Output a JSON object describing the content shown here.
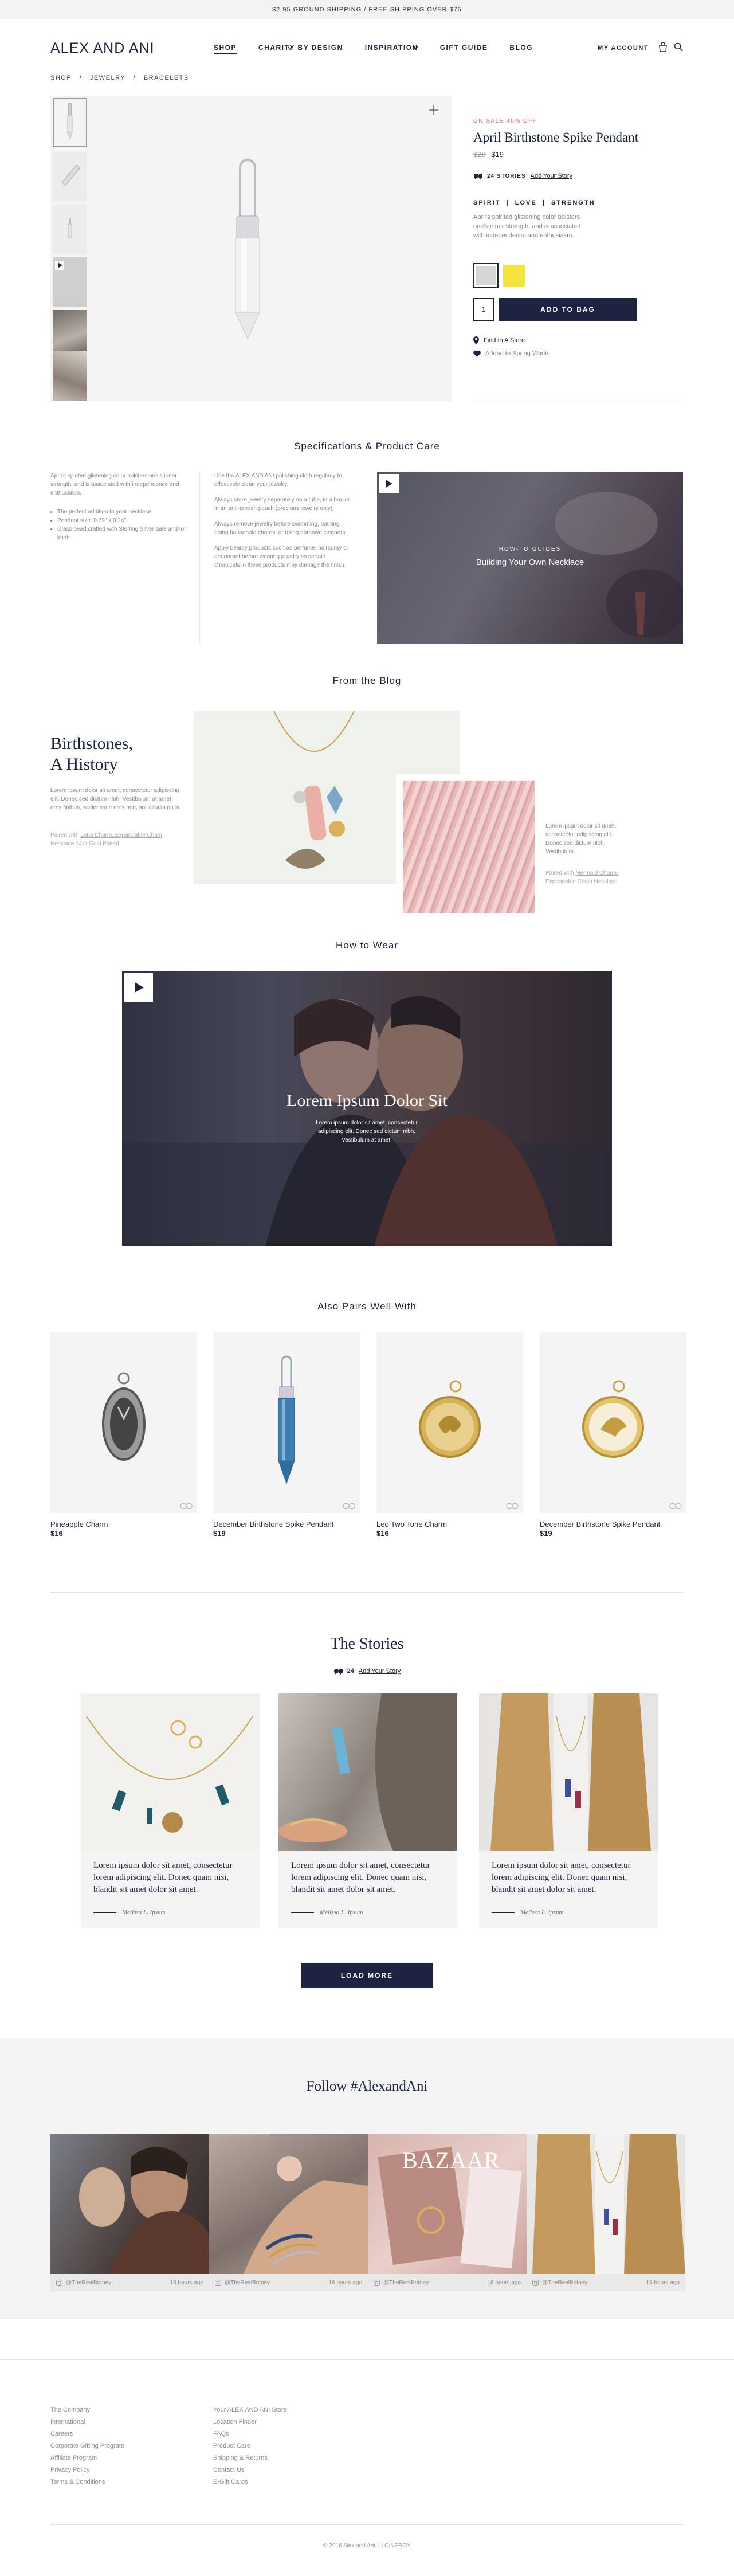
{
  "topbar": {
    "text": "$2.95 GROUND SHIPPING  /  FREE SHIPPING OVER $75"
  },
  "header": {
    "logo": "ALEX AND ANI",
    "nav": [
      "SHOP",
      "CHARITY BY DESIGN",
      "INSPIRATION",
      "GIFT GUIDE",
      "BLOG"
    ],
    "account": "MY ACCOUNT"
  },
  "breadcrumb": [
    "SHOP",
    "JEWELRY",
    "BRACELETS"
  ],
  "product": {
    "sale_label": "ON SALE 40% OFF",
    "name": "April Birthstone Spike Pendant",
    "old_price": "$28",
    "price": "$19",
    "stories_count": "24 STORIES",
    "add_story": "Add Your Story",
    "tags": [
      "SPIRIT",
      "LOVE",
      "STRENGTH"
    ],
    "description": "April's spirited glistening color bolsters one's inner strength, and is associated with independence and enthusiasm.",
    "swatch_colors": [
      "#d6d6d6",
      "#f5e23a"
    ],
    "quantity": "1",
    "add_to_bag": "ADD TO BAG",
    "find_store": "Find In A Store",
    "wishlist": "Added to Spring Wants"
  },
  "specs": {
    "title": "Specifications & Product Care",
    "col1_text": "April's spirited glistening color bolsters one's inner strength, and is associated with independence and enthusiasm.",
    "col1_bullets": [
      "The perfect addition to your necklace",
      "Pendant size: 0.79\" x 0.24\"",
      "Glass bead crafted with Sterling Silver bale and tor knob"
    ],
    "col2_paras": [
      "Use the ALEX AND ANI polishing cloth regularly to effectively clean your jewelry.",
      "Always store jewelry separately on a tube, in a box or in an anti-tarnish pouch (precious jewelry only).",
      "Always remove jewelry before swimming, bathing, doing household chores, or using abrasive cleaners.",
      "Apply beauty products such as perfume, hairspray or deodorant before wearing jewelry as certain chemicals in these products may damage the finish."
    ],
    "video_kicker": "HOW-TO GUIDES",
    "video_title": "Building Your Own Necklace"
  },
  "blog": {
    "title": "From the Blog",
    "headline_line1": "Birthstones,",
    "headline_line2": "A History",
    "body": "Lorem ipsum dolor sit amet, consectetur adipiscing elit. Donec sed dictum nibh. Vestibulum at amet eros finibus, scelerisque eros non, sollicitudin nulla.",
    "paired_label": "Paired with",
    "paired_link": "Luna Charm, Expandable Chain Necklace 14Kt Gold Plated",
    "body2": "Lorem ipsum dolor sit amet, consectetur adipiscing elit. Donec sed dictum nibh. Vestibulum.",
    "paired_link2": "Mermaid Charm, Expandable Chain Necklace"
  },
  "how_to_wear": {
    "title": "How to Wear",
    "video_title": "Lorem Ipsum Dolor Sit",
    "video_sub": "Lorem ipsum dolor sit amet, consectetur adipiscing elit. Donec sed dictum nibh. Vestibulum at amet."
  },
  "pairs": {
    "title": "Also Pairs Well With",
    "items": [
      {
        "name": "Pineapple Charm",
        "price": "$16"
      },
      {
        "name": "December Birthstone Spike Pendant",
        "price": "$19"
      },
      {
        "name": "Leo Two Tone Charm",
        "price": "$16"
      },
      {
        "name": "December Birthstone Spike Pendant",
        "price": "$19"
      }
    ]
  },
  "stories": {
    "title": "The Stories",
    "count": "24",
    "add_story": "Add Your Story",
    "items": [
      {
        "text": "Lorem ipsum dolor sit amet, consectetur lorem adipiscing elit. Donec quam nisi, blandit sit amet dolor sit amet.",
        "author": "Melissa L. Ipsum"
      },
      {
        "text": "Lorem ipsum dolor sit amet, consectetur lorem adipiscing elit. Donec quam nisi, blandit sit amet dolor sit amet.",
        "author": "Melissa L. Ipsum"
      },
      {
        "text": "Lorem ipsum dolor sit amet, consectetur lorem adipiscing elit. Donec quam nisi, blandit sit amet dolor sit amet.",
        "author": "Melissa L. Ipsum"
      }
    ],
    "load_more": "LOAD MORE"
  },
  "instagram": {
    "title": "Follow #AlexandAni",
    "posts": [
      {
        "handle": "@TheRealBritney",
        "time": "16 hours ago"
      },
      {
        "handle": "@TheRealBritney",
        "time": "16 hours ago"
      },
      {
        "handle": "@TheRealBritney",
        "time": "16 hours ago"
      },
      {
        "handle": "@TheRealBritney",
        "time": "16 hours ago"
      }
    ],
    "magazine_word": "BAZAAR"
  },
  "footer": {
    "col1": [
      "The Company",
      "International",
      "Careers",
      "Corporate Gifting Program",
      "Affiliate Program",
      "Privacy Policy",
      "Terms & Conditions"
    ],
    "col2": [
      "Your ALEX AND ANI Store",
      "Location Finder",
      "FAQs",
      "Product Care",
      "Shipping & Returns",
      "Contact Us",
      "E-Gift Cards"
    ],
    "copyright": "© 2016 Alex and Ani, LLC/NEROY"
  }
}
